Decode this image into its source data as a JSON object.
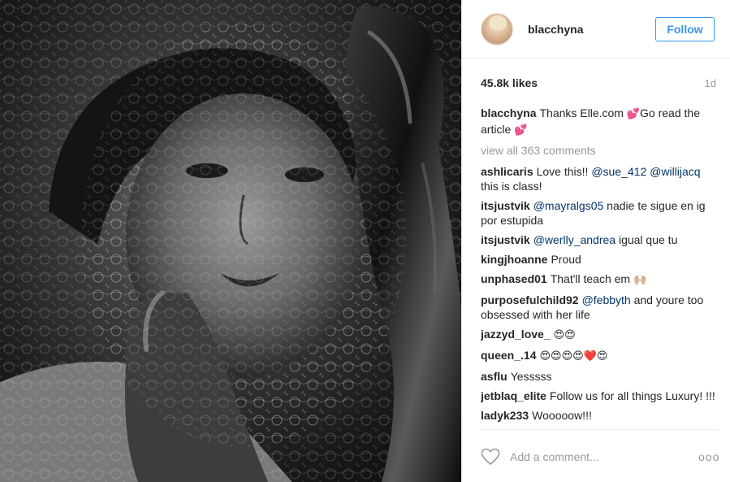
{
  "post": {
    "username": "blacchyna",
    "follow_label": "Follow",
    "likes": "45.8k likes",
    "time_ago": "1d",
    "photo_alt": "Black and white portrait with lace veil and leather gloves"
  },
  "caption": {
    "author": "blacchyna",
    "text_1": "Thanks Elle.com ",
    "emoji_1": "💕",
    "text_2": "Go read the article ",
    "emoji_2": "💕"
  },
  "view_all": "view all 363 comments",
  "comments": [
    {
      "author": "ashlicaris",
      "pre": "Love this!! ",
      "mentions": [
        "@sue_412",
        "@willijacq"
      ],
      "post": " this is class!"
    },
    {
      "author": "itsjustvik",
      "mention": "@mayralgs05",
      "text": " nadie te sigue en ig por estupida"
    },
    {
      "author": "itsjustvik",
      "mention": "@werlly_andrea",
      "text": " igual que tu"
    },
    {
      "author": "kingjhoanne",
      "text": "Proud"
    },
    {
      "author": "unphased01",
      "text": "That'll teach em ",
      "emoji": "🙌🏼"
    },
    {
      "author": "purposefulchild92",
      "mention": "@febbyth",
      "text": " and youre too obsessed with her life"
    },
    {
      "author": "jazzyd_love_",
      "emoji": "😍😍"
    },
    {
      "author": "queen_.14",
      "emoji": "😍😍😍😍❤️😍"
    },
    {
      "author": "asflu",
      "text": "Yesssss"
    },
    {
      "author": "jetblaq_elite",
      "text": "Follow us for all things Luxury! !!!"
    },
    {
      "author": "ladyk233",
      "text": "Wooooow!!!"
    }
  ],
  "add_comment": {
    "placeholder": "Add a comment...",
    "more_label": "ooo"
  },
  "icons": {
    "heart": "heart-outline-icon",
    "more": "more-options-icon"
  },
  "colors": {
    "accent": "#3897f0",
    "mention": "#003569",
    "muted": "#999999",
    "border": "#efefef"
  }
}
